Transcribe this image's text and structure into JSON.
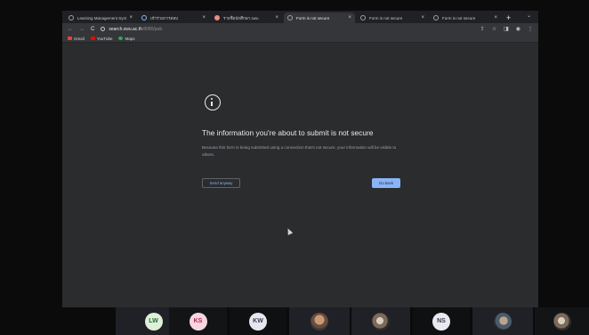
{
  "browser": {
    "tabs": [
      {
        "title": "Learning Management Syst",
        "active": false
      },
      {
        "title": "เข้าร่วมการสอบ",
        "active": false
      },
      {
        "title": "รายชื่อนักศึกษา.swu",
        "active": false
      },
      {
        "title": "Form is not secure",
        "active": true
      },
      {
        "title": "Form is not secure",
        "active": false
      },
      {
        "title": "Form is not secure",
        "active": false
      }
    ],
    "new_tab": "+",
    "url_host": "search.swu.ac.th",
    "url_port": ":8080/pub",
    "bookmarks": [
      {
        "label": "Gmail",
        "color": "#ea4335"
      },
      {
        "label": "YouTube",
        "color": "#ff0000"
      },
      {
        "label": "Maps",
        "color": "#34a853"
      }
    ]
  },
  "interstitial": {
    "heading": "The information you're about to submit is not secure",
    "description": "Because this form is being submitted using a connection that's not secure, your information will be visible to others.",
    "send_anyway": "Send anyway",
    "go_back": "Go back"
  },
  "participants": [
    {
      "initials": "LW",
      "avatar_bg": "#dff0d8",
      "avatar_fg": "#1e6b3a"
    },
    {
      "initials": "KS",
      "avatar_bg": "#f6d6e0",
      "avatar_fg": "#b3264f"
    },
    {
      "initials": "KW",
      "avatar_bg": "#e6e6ec",
      "avatar_fg": "#3b3b55"
    },
    {
      "initials": "",
      "photo": "a"
    },
    {
      "initials": "",
      "photo": "b"
    },
    {
      "initials": "NS",
      "avatar_bg": "#e9e9f0",
      "avatar_fg": "#3b3b55"
    },
    {
      "initials": "",
      "photo": "c"
    },
    {
      "initials": "",
      "photo": "b"
    }
  ]
}
